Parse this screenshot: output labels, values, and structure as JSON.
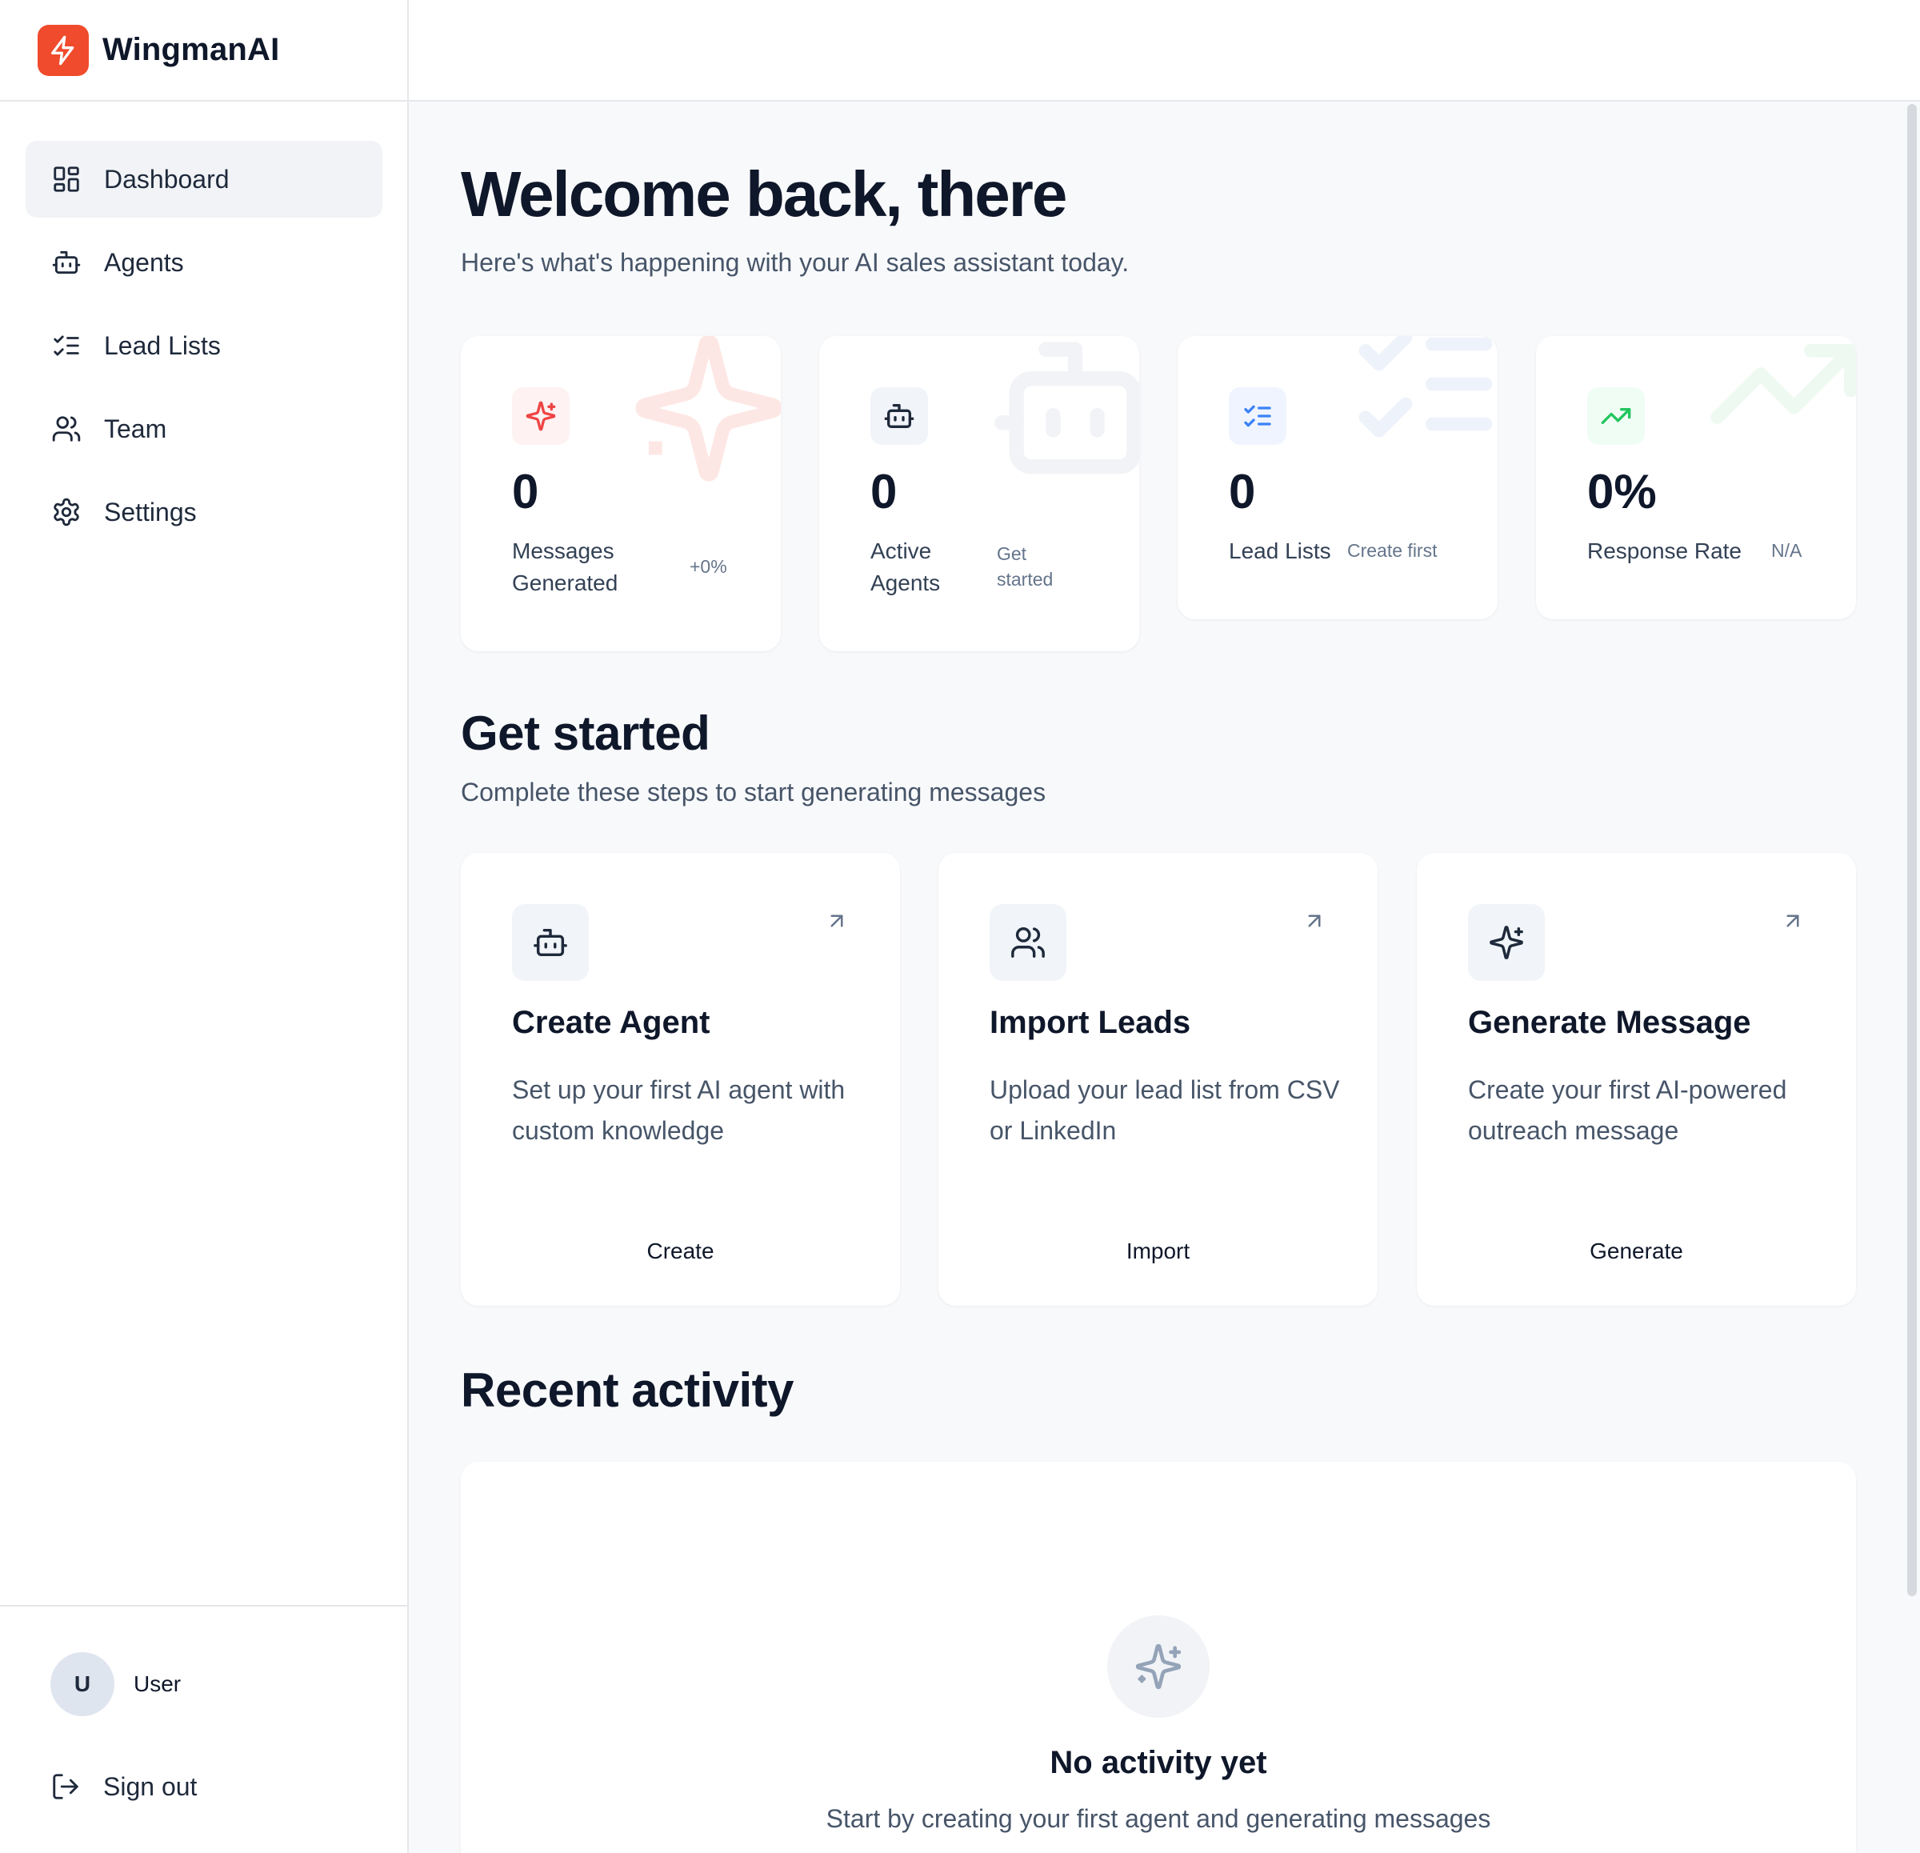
{
  "brand": {
    "name": "WingmanAI",
    "accent": "#f04b2c"
  },
  "nav": {
    "items": [
      {
        "label": "Dashboard",
        "icon": "dashboard-icon",
        "active": true
      },
      {
        "label": "Agents",
        "icon": "bot-icon",
        "active": false
      },
      {
        "label": "Lead Lists",
        "icon": "list-checks-icon",
        "active": false
      },
      {
        "label": "Team",
        "icon": "users-icon",
        "active": false
      },
      {
        "label": "Settings",
        "icon": "gear-icon",
        "active": false
      }
    ]
  },
  "user": {
    "initial": "U",
    "name": "User"
  },
  "signout": {
    "label": "Sign out",
    "icon": "logout-icon"
  },
  "header": {
    "title": "Welcome back, there",
    "subtitle": "Here's what's happening with your AI sales assistant today."
  },
  "stats": [
    {
      "value": "0",
      "label_line1": "Messages",
      "label_line2": "Generated",
      "meta_line1": "+0%",
      "meta_line2": "",
      "icon": "sparkles-icon",
      "color": "#ef4444"
    },
    {
      "value": "0",
      "label_line1": "Active",
      "label_line2": "Agents",
      "meta_line1": "Get",
      "meta_line2": "started",
      "icon": "bot-icon",
      "color": "#1e293b"
    },
    {
      "value": "0",
      "label_line1": "Lead Lists",
      "label_line2": "",
      "meta_line1": "Create first",
      "meta_line2": "",
      "icon": "list-checks-icon",
      "color": "#3b82f6"
    },
    {
      "value": "0%",
      "label_line1": "Response Rate",
      "label_line2": "",
      "meta_line1": "N/A",
      "meta_line2": "",
      "icon": "trending-up-icon",
      "color": "#22c55e"
    }
  ],
  "get_started": {
    "title": "Get started",
    "subtitle": "Complete these steps to start generating messages",
    "steps": [
      {
        "title": "Create Agent",
        "description": "Set up your first AI agent with custom knowledge",
        "button": "Create",
        "icon": "bot-icon"
      },
      {
        "title": "Import Leads",
        "description": "Upload your lead list from CSV or LinkedIn",
        "button": "Import",
        "icon": "users-icon"
      },
      {
        "title": "Generate Message",
        "description": "Create your first AI-powered outreach message",
        "button": "Generate",
        "icon": "sparkles-icon"
      }
    ]
  },
  "recent_activity": {
    "title": "Recent activity",
    "empty_title": "No activity yet",
    "empty_subtitle": "Start by creating your first agent and generating messages"
  }
}
